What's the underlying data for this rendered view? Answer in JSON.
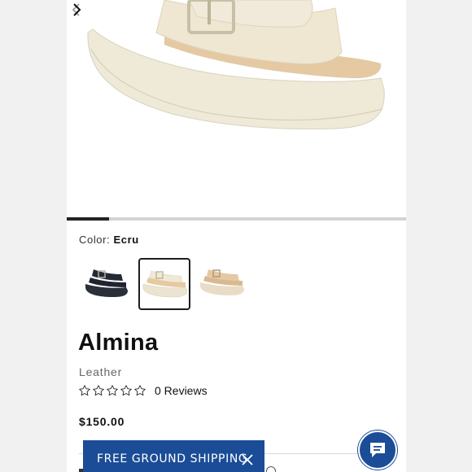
{
  "gallery": {
    "progress_fraction": 0.125,
    "prev_icon": "chevron-left-icon",
    "next_icon": "chevron-right-icon"
  },
  "color": {
    "label": "Color:",
    "value": "Ecru",
    "swatches": [
      {
        "name": "black",
        "hex": "#1f2530",
        "selected": false
      },
      {
        "name": "ecru",
        "hex": "#ebe4cf",
        "selected": true
      },
      {
        "name": "tan",
        "hex": "#e2c9a6",
        "selected": false
      }
    ]
  },
  "product": {
    "name": "Almina",
    "material": "Leather",
    "rating_stars": 0,
    "rating_max": 5,
    "reviews_label": "0 Reviews",
    "price": "$150.00"
  },
  "banner": {
    "text": "FREE GROUND SHIPPING",
    "close_icon": "close-icon",
    "color": "#1b4c97"
  },
  "chat": {
    "icon": "chat-bubble-icon",
    "color": "#1b4c97"
  }
}
